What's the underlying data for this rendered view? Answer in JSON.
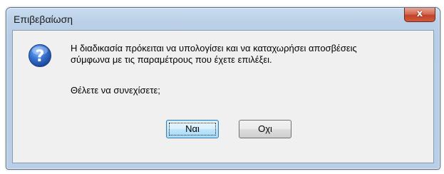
{
  "dialog": {
    "title": "Επιβεβαίωση",
    "close_label": "x",
    "message_lines": [
      "Η διαδικασία πρόκειται να υπολογίσει και να καταχωρήσει αποσβέσεις",
      "σύμφωνα με τις παραμέτρους που έχετε επιλέξει."
    ],
    "question": "Θέλετε να συνεχίσετε;",
    "icon": "question-icon",
    "buttons": {
      "yes_label": "Ναι",
      "no_label": "Οχι"
    }
  },
  "colors": {
    "frame": "#b9cfe7",
    "client": "#f0f0f0",
    "close_button": "#c2432a",
    "icon_blue": "#2a62c0"
  }
}
